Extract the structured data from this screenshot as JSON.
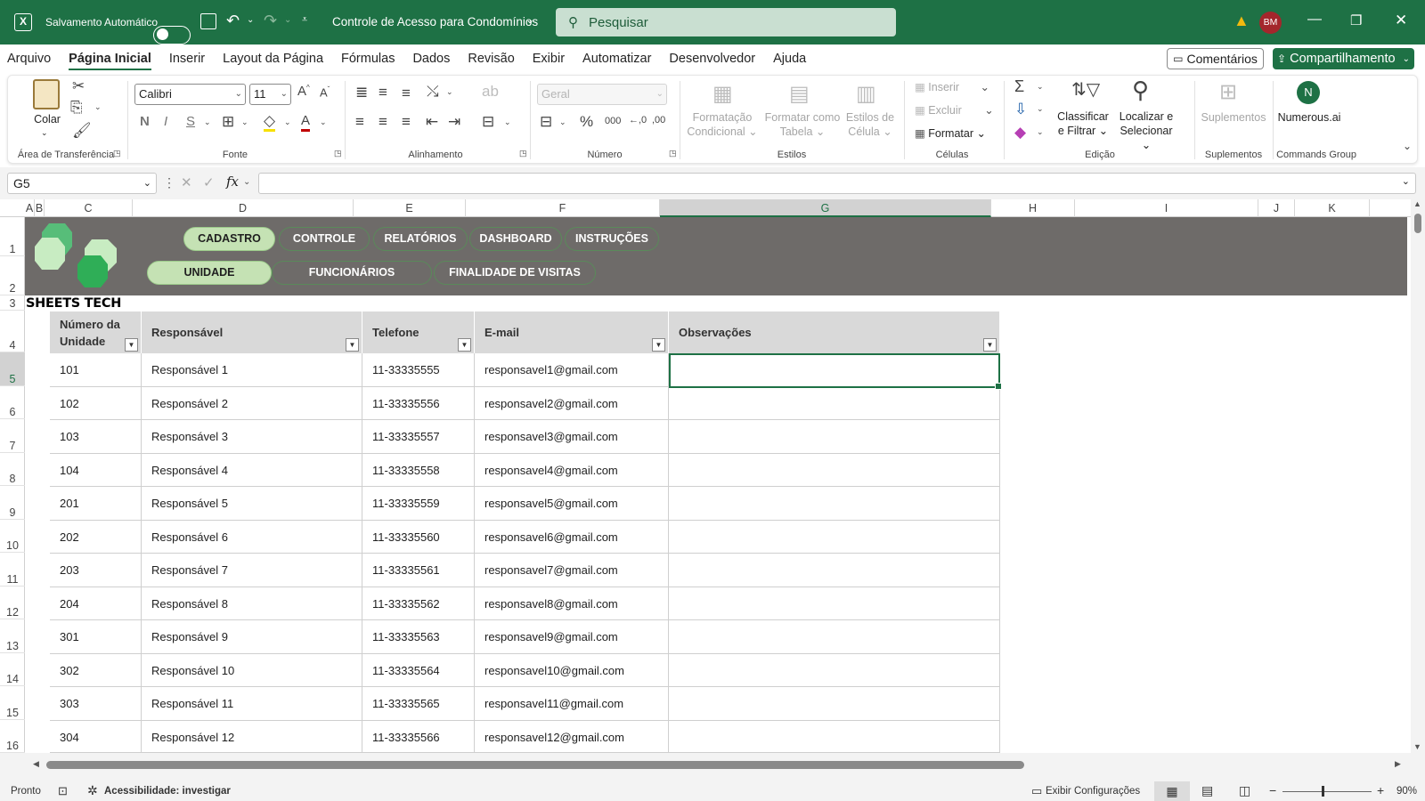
{
  "titlebar": {
    "autosave_label": "Salvamento Automático",
    "doc_title": "Controle de Acesso para Condomínios",
    "search_placeholder": "Pesquisar",
    "user_initials": "BM"
  },
  "menu": {
    "tabs": [
      "Arquivo",
      "Página Inicial",
      "Inserir",
      "Layout da Página",
      "Fórmulas",
      "Dados",
      "Revisão",
      "Exibir",
      "Automatizar",
      "Desenvolvedor",
      "Ajuda"
    ],
    "active_index": 1,
    "comments_label": "Comentários",
    "share_label": "Compartilhamento"
  },
  "ribbon": {
    "groups": {
      "clipboard": "Área de Transferência",
      "font": "Fonte",
      "alignment": "Alinhamento",
      "number": "Número",
      "styles": "Estilos",
      "cells": "Células",
      "editing": "Edição",
      "addins": "Suplementos",
      "commands": "Commands Group"
    },
    "paste_label": "Colar",
    "font_name": "Calibri",
    "font_size": "11",
    "number_format": "Geral",
    "cond_format": [
      "Formatação",
      "Condicional"
    ],
    "format_table": [
      "Formatar como",
      "Tabela"
    ],
    "cell_styles": [
      "Estilos de",
      "Célula"
    ],
    "insert_label": "Inserir",
    "delete_label": "Excluir",
    "format_label": "Formatar",
    "sort_filter": [
      "Classificar",
      "e Filtrar"
    ],
    "find_select": [
      "Localizar e",
      "Selecionar"
    ],
    "addins_label": "Suplementos",
    "numerous_label": "Numerous.ai"
  },
  "formula_bar": {
    "name_box": "G5",
    "formula": ""
  },
  "columns": [
    "A",
    "B",
    "C",
    "D",
    "E",
    "F",
    "G",
    "H",
    "I",
    "J",
    "K"
  ],
  "selected_column": "G",
  "rows": [
    "1",
    "2",
    "3",
    "4",
    "5",
    "6",
    "7",
    "8",
    "9",
    "10",
    "11",
    "12",
    "13",
    "14",
    "15",
    "16"
  ],
  "selected_row": "5",
  "banner": {
    "nav_top": [
      "CADASTRO",
      "CONTROLE",
      "RELATÓRIOS",
      "DASHBOARD",
      "INSTRUÇÕES"
    ],
    "nav_bottom": [
      "UNIDADE",
      "FUNCIONÁRIOS",
      "FINALIDADE DE VISITAS"
    ],
    "brand": "SHEETS TECH"
  },
  "table": {
    "headers": [
      "Número da Unidade",
      "Responsável",
      "Telefone",
      "E-mail",
      "Observações"
    ],
    "rows": [
      [
        "101",
        "Responsável 1",
        "11-33335555",
        "responsavel1@gmail.com",
        ""
      ],
      [
        "102",
        "Responsável 2",
        "11-33335556",
        "responsavel2@gmail.com",
        ""
      ],
      [
        "103",
        "Responsável 3",
        "11-33335557",
        "responsavel3@gmail.com",
        ""
      ],
      [
        "104",
        "Responsável 4",
        "11-33335558",
        "responsavel4@gmail.com",
        ""
      ],
      [
        "201",
        "Responsável 5",
        "11-33335559",
        "responsavel5@gmail.com",
        ""
      ],
      [
        "202",
        "Responsável 6",
        "11-33335560",
        "responsavel6@gmail.com",
        ""
      ],
      [
        "203",
        "Responsável 7",
        "11-33335561",
        "responsavel7@gmail.com",
        ""
      ],
      [
        "204",
        "Responsável 8",
        "11-33335562",
        "responsavel8@gmail.com",
        ""
      ],
      [
        "301",
        "Responsável 9",
        "11-33335563",
        "responsavel9@gmail.com",
        ""
      ],
      [
        "302",
        "Responsável 10",
        "11-33335564",
        "responsavel10@gmail.com",
        ""
      ],
      [
        "303",
        "Responsável 11",
        "11-33335565",
        "responsavel11@gmail.com",
        ""
      ],
      [
        "304",
        "Responsável 12",
        "11-33335566",
        "responsavel12@gmail.com",
        ""
      ]
    ]
  },
  "status": {
    "ready": "Pronto",
    "accessibility": "Acessibilidade: investigar",
    "display_settings": "Exibir Configurações",
    "zoom": "90%"
  },
  "colors": {
    "excel_green": "#1e7145",
    "banner_gray": "#6e6b69",
    "pill_active": "#c5e2b4",
    "header_gray": "#d9d9d9"
  }
}
